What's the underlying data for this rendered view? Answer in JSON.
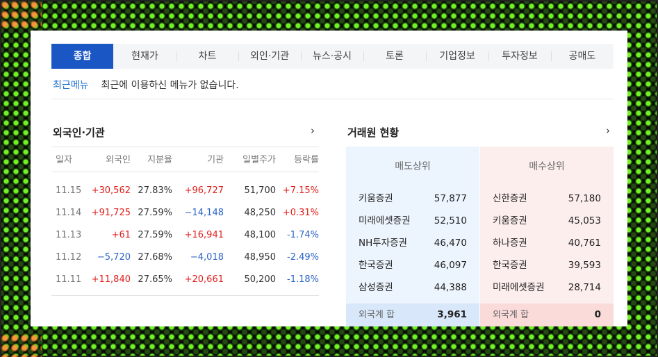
{
  "tabs": [
    "종합",
    "현재가",
    "차트",
    "외인·기관",
    "뉴스·공시",
    "토론",
    "기업정보",
    "투자정보",
    "공매도"
  ],
  "recent_menu": {
    "label": "최근메뉴",
    "message": "최근에 이용하신 메뉴가 없습니다."
  },
  "foreign_institution": {
    "title": "외국인·기관",
    "headers": [
      "일자",
      "외국인",
      "지분율",
      "기관",
      "일별주가",
      "등락률"
    ],
    "rows": [
      {
        "date": "11.15",
        "foreign": "+30,562",
        "foreign_dir": "up",
        "share": "27.83%",
        "institution": "+96,727",
        "inst_dir": "up",
        "price": "51,700",
        "change": "+7.15%",
        "change_dir": "up"
      },
      {
        "date": "11.14",
        "foreign": "+91,725",
        "foreign_dir": "up",
        "share": "27.59%",
        "institution": "−14,148",
        "inst_dir": "down",
        "price": "48,250",
        "change": "+0.31%",
        "change_dir": "up"
      },
      {
        "date": "11.13",
        "foreign": "+61",
        "foreign_dir": "up",
        "share": "27.59%",
        "institution": "+16,941",
        "inst_dir": "up",
        "price": "48,100",
        "change": "-1.74%",
        "change_dir": "down"
      },
      {
        "date": "11.12",
        "foreign": "−5,720",
        "foreign_dir": "down",
        "share": "27.68%",
        "institution": "−4,018",
        "inst_dir": "down",
        "price": "48,950",
        "change": "-2.49%",
        "change_dir": "down"
      },
      {
        "date": "11.11",
        "foreign": "+11,840",
        "foreign_dir": "up",
        "share": "27.65%",
        "institution": "+20,661",
        "inst_dir": "up",
        "price": "50,200",
        "change": "-1.18%",
        "change_dir": "down"
      }
    ]
  },
  "brokers": {
    "title": "거래원 현황",
    "sell": {
      "header": "매도상위",
      "items": [
        {
          "name": "키움증권",
          "value": "57,877"
        },
        {
          "name": "미래에셋증권",
          "value": "52,510"
        },
        {
          "name": "NH투자증권",
          "value": "46,470"
        },
        {
          "name": "한국증권",
          "value": "46,097"
        },
        {
          "name": "삼성증권",
          "value": "44,388"
        }
      ],
      "sum_label": "외국계 합",
      "sum_value": "3,961"
    },
    "buy": {
      "header": "매수상위",
      "items": [
        {
          "name": "신한증권",
          "value": "57,180"
        },
        {
          "name": "키움증권",
          "value": "45,053"
        },
        {
          "name": "하나증권",
          "value": "40,761"
        },
        {
          "name": "한국증권",
          "value": "39,593"
        },
        {
          "name": "미래에셋증권",
          "value": "28,714"
        }
      ],
      "sum_label": "외국계 합",
      "sum_value": "0"
    }
  },
  "icons": {
    "more": "chevron-right-icon"
  },
  "colors": {
    "accent": "#1a56c4",
    "up": "#e0201c",
    "down": "#2a63c6"
  }
}
